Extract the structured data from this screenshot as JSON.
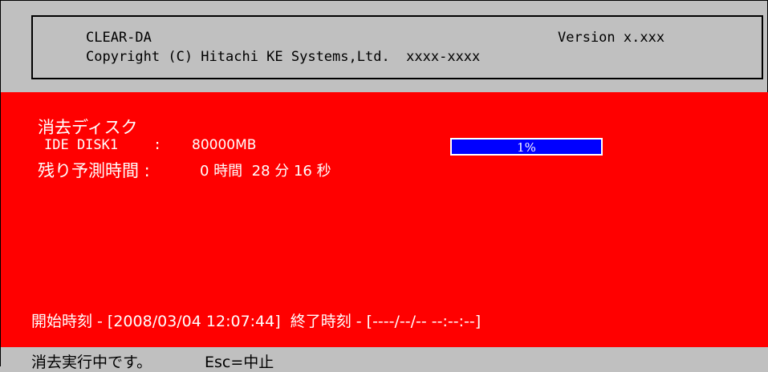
{
  "header": {
    "app_name": "CLEAR-DA",
    "version": "Version x.xxx",
    "copyright": "Copyright (C) Hitachi KE Systems,Ltd.  xxxx-xxxx"
  },
  "main": {
    "target_label": "消去ディスク",
    "disk_name": "IDE DISK1",
    "disk_separator": ":",
    "disk_size": "80000MB",
    "remaining_label": "残り予測時間 :",
    "remaining_value": "0 時間  28 分 16 秒",
    "progress_text": "1%",
    "progress_fraction": 0.01,
    "time_line": "開始時刻 - [2008/03/04 12:07:44]  終了時刻 - [----/--/-- --:--:--]"
  },
  "statusbar": {
    "status": "消去実行中です。",
    "hint": "Esc=中止"
  },
  "colors": {
    "main_background": "#ff0000",
    "progress_bar": "#0000ff",
    "chrome": "#c0c0c0"
  }
}
